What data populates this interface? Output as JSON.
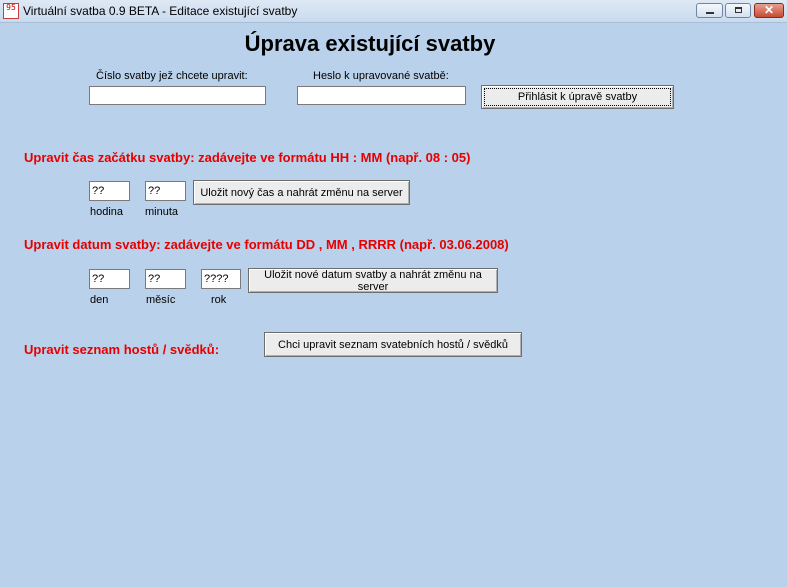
{
  "window": {
    "title": "Virtuální svatba 0.9 BETA - Editace existující svatby",
    "icon_text": "95",
    "min_icon": "minimize-icon",
    "max_icon": "maximize-icon",
    "close_icon": "close-icon",
    "close_glyph": "✕"
  },
  "page": {
    "heading": "Úprava existující svatby"
  },
  "login": {
    "number_label": "Číslo svatby jež chcete upravit:",
    "number_value": "",
    "password_label": "Heslo k upravované svatbě:",
    "password_value": "",
    "login_button": "Přihlásit k úpravě svatby"
  },
  "time": {
    "instruction": "Upravit čas začátku svatby: zadávejte ve formátu HH : MM (např. 08 : 05)",
    "hour_value": "??",
    "minute_value": "??",
    "hour_label": "hodina",
    "minute_label": "minuta",
    "save_button": "Uložit nový čas a nahrát změnu na server"
  },
  "date": {
    "instruction": "Upravit datum svatby: zadávejte ve formátu DD , MM , RRRR (např. 03.06.2008)",
    "day_value": "??",
    "month_value": "??",
    "year_value": "????",
    "day_label": "den",
    "month_label": "měsíc",
    "year_label": "rok",
    "save_button": "Uložit nové datum svatby a nahrát změnu na server"
  },
  "guests": {
    "instruction": "Upravit seznam hostů / svědků:",
    "edit_button": "Chci upravit seznam svatebních hostů / svědků"
  }
}
